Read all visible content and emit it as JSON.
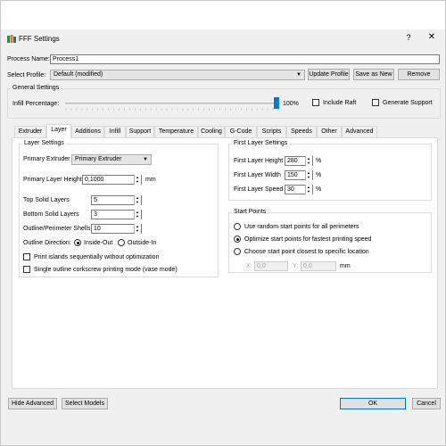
{
  "window": {
    "title": "FFF Settings",
    "help_glyph": "?",
    "close_glyph": "✕"
  },
  "process": {
    "name_label": "Process Name:",
    "name_value": "Process1"
  },
  "profile": {
    "label": "Select Profile:",
    "selected": "Default (modified)",
    "update_label": "Update Profile",
    "save_new_label": "Save as New",
    "remove_label": "Remove"
  },
  "general": {
    "title": "General Settings",
    "infill_label": "Infill Percentage:",
    "infill_value": "100%",
    "infill_fraction": 1.0,
    "include_raft_label": "Include Raft",
    "generate_support_label": "Generate Support"
  },
  "tabs": [
    "Extruder",
    "Layer",
    "Additions",
    "Infill",
    "Support",
    "Temperature",
    "Cooling",
    "G-Code",
    "Scripts",
    "Speeds",
    "Other",
    "Advanced"
  ],
  "active_tab": "Layer",
  "layer_settings": {
    "title": "Layer Settings",
    "primary_extruder_label": "Primary Extruder",
    "primary_extruder_value": "Primary Extruder",
    "primary_layer_height_label": "Primary Layer Height",
    "primary_layer_height_value": "0,1000",
    "primary_layer_height_unit": "mm",
    "top_solid_label": "Top Solid Layers",
    "top_solid_value": "5",
    "bottom_solid_label": "Bottom Solid Layers",
    "bottom_solid_value": "3",
    "outline_shells_label": "Outline/Perimeter Shells",
    "outline_shells_value": "10",
    "outline_direction_label": "Outline Direction:",
    "inside_out_label": "Inside-Out",
    "outside_in_label": "Outside-In",
    "print_islands_label": "Print islands sequentially without optimization",
    "single_outline_label": "Single outline corkscrew printing mode (vase mode)"
  },
  "first_layer": {
    "title": "First Layer Settings",
    "height_label": "First Layer Height",
    "height_value": "280",
    "width_label": "First Layer Width",
    "width_value": "150",
    "speed_label": "First Layer Speed",
    "speed_value": "30",
    "unit": "%"
  },
  "start_points": {
    "title": "Start Points",
    "random_label": "Use random start points for all perimeters",
    "optimize_label": "Optimize start points for fastest printing speed",
    "closest_label": "Choose start point closest to specific location",
    "x_label": "X:",
    "x_value": "0,0",
    "y_label": "Y:",
    "y_value": "0,0",
    "unit": "mm"
  },
  "footer": {
    "hide_advanced_label": "Hide Advanced",
    "select_models_label": "Select Models",
    "ok_label": "OK",
    "cancel_label": "Cancel"
  },
  "colors": {
    "accent": "#0078d7",
    "window_bg": "#f0f0f0",
    "panel_bg": "#ffffff"
  }
}
